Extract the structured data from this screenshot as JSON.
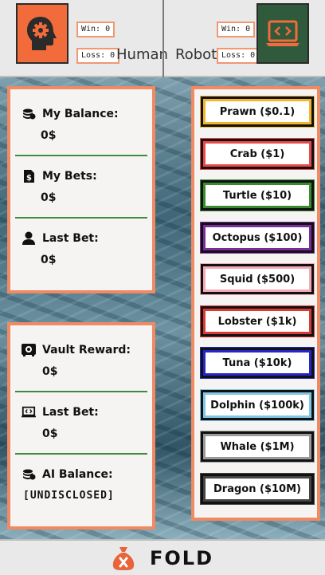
{
  "players": {
    "human": {
      "name": "Human",
      "win": "Win: 0",
      "loss": "Loss: 0",
      "icon": "head-gear-icon",
      "color": "#f26b3b"
    },
    "robot": {
      "name": "Robot",
      "win": "Win: 0",
      "loss": "Loss: 0",
      "icon": "laptop-code-icon",
      "color": "#2f5a3c"
    }
  },
  "human_panel": {
    "balance_label": "My Balance:",
    "balance_value": "0$",
    "bets_label": "My Bets:",
    "bets_value": "0$",
    "last_bet_label": "Last Bet:",
    "last_bet_value": "0$"
  },
  "ai_panel": {
    "vault_label": "Vault Reward:",
    "vault_value": "0$",
    "last_bet_label": "Last Bet:",
    "last_bet_value": "0$",
    "balance_label": "AI Balance:",
    "balance_value": "[UNDISCLOSED]"
  },
  "bets": [
    {
      "label": "Prawn ($0.1)",
      "color": "#f2b52c"
    },
    {
      "label": "Crab ($1)",
      "color": "#e84a4a"
    },
    {
      "label": "Turtle ($10)",
      "color": "#3a8a2e"
    },
    {
      "label": "Octopus ($100)",
      "color": "#7b2c9a"
    },
    {
      "label": "Squid ($500)",
      "color": "#f3a8b4"
    },
    {
      "label": "Lobster ($1k)",
      "color": "#d93a36"
    },
    {
      "label": "Tuna ($10k)",
      "color": "#2525c9"
    },
    {
      "label": "Dolphin ($100k)",
      "color": "#7fc6e6"
    },
    {
      "label": "Whale ($1M)",
      "color": "#9a9a9a"
    },
    {
      "label": "Dragon ($10M)",
      "color": "#444444"
    }
  ],
  "fold": {
    "label": "FOLD",
    "icon": "money-bag-icon",
    "color": "#e8643a"
  },
  "accents": {
    "panel_border": "#ef8a62",
    "separator": "#3f8a3c"
  }
}
